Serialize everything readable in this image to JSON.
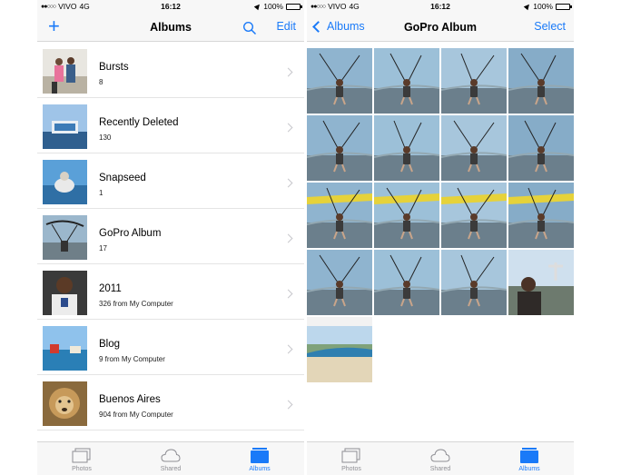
{
  "left": {
    "status": {
      "carrier": "VIVO",
      "network": "4G",
      "time": "16:12",
      "battery": "100%"
    },
    "nav": {
      "title": "Albums",
      "edit_label": "Edit",
      "add_icon": "plus-icon",
      "search_icon": "search-icon"
    },
    "albums": [
      {
        "name": "Bursts",
        "count": "8"
      },
      {
        "name": "Recently Deleted",
        "count": "130"
      },
      {
        "name": "Snapseed",
        "count": "1"
      },
      {
        "name": "GoPro Album",
        "count": "17"
      },
      {
        "name": "2011",
        "count": "326 from My Computer"
      },
      {
        "name": "Blog",
        "count": "9 from My Computer"
      },
      {
        "name": "Buenos Aires",
        "count": "904 from My Computer"
      }
    ],
    "tabs": [
      {
        "label": "Photos",
        "icon": "photos-icon"
      },
      {
        "label": "Shared",
        "icon": "cloud-icon"
      },
      {
        "label": "Albums",
        "icon": "albums-icon",
        "active": true
      }
    ]
  },
  "right": {
    "status": {
      "carrier": "VIVO",
      "network": "4G",
      "time": "16:12",
      "battery": "100%"
    },
    "nav": {
      "title": "GoPro Album",
      "back_label": "Albums",
      "select_label": "Select"
    },
    "photo_count": 17,
    "tabs": [
      {
        "label": "Photos",
        "icon": "photos-icon"
      },
      {
        "label": "Shared",
        "icon": "cloud-icon"
      },
      {
        "label": "Albums",
        "icon": "albums-icon",
        "active": true
      }
    ]
  },
  "colors": {
    "accent": "#1a7af8",
    "bar_bg": "#f7f7f7",
    "chevron": "#c7c7cc",
    "inactive_tab": "#8e8e93"
  }
}
